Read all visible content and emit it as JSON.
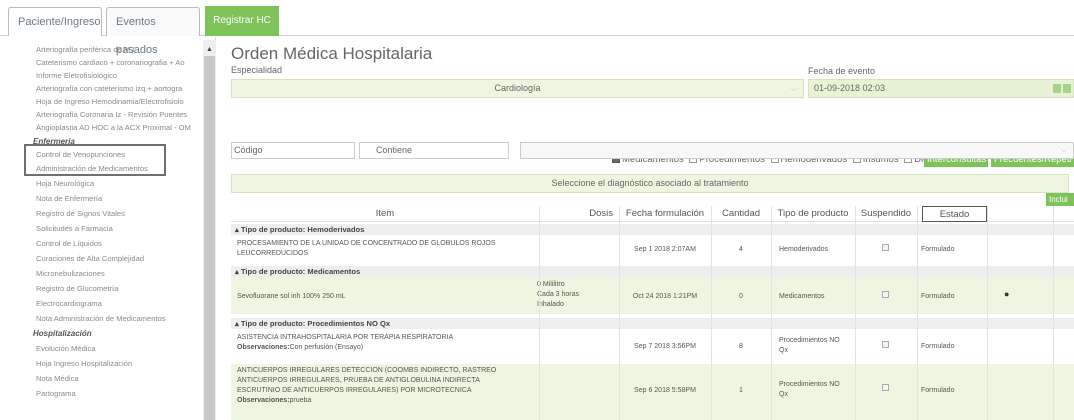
{
  "tabs": {
    "patient": "Paciente/Ingreso",
    "past_events": "Eventos pasados",
    "register": "Registrar HC"
  },
  "sidebar": {
    "items_top": [
      "Arteriografía periférica de M.I",
      "Cateterismo cardiaco + coronariografia + Ao",
      "Informe Eletrofisiológico",
      "Arteriografía con cateterismo izq.+ aortogra",
      "Hoja de Ingreso Hemodinamia/Electrofisiolo",
      "Arteriografía Coronaria Iz - Revisión Puentes",
      "Angioplastia AD HOC a la ACX Proximal - OM"
    ],
    "section_enfermeria": "Enfermería",
    "items_enfermeria": [
      "Control de Venopunciones",
      "Administración de Medicamentos",
      "Hoja Neurológica",
      "Nota de Enfermería",
      "Registro de Signos Vitales",
      "Solicitudes a Farmacia",
      "Control de Líquidos",
      "Curaciones de Alta Complejidad",
      "Micronebulizaciones",
      "Registro de Glucometría",
      "Electrocardiograma",
      "Nota Administración de Medicamentos"
    ],
    "section_hosp": "Hospitalización",
    "items_hosp": [
      "Evolución Médica",
      "Hoja Ingreso Hospitalización",
      "Nota Médica",
      "Partograma"
    ]
  },
  "form": {
    "title": "Orden Médica Hospitalaria",
    "especialidad_label": "Especialidad",
    "especialidad_value": "Cardiología",
    "fecha_label": "Fecha de evento",
    "fecha_value": "01-09-2018 02:03",
    "checks": {
      "medicamentos": "Medicamentos",
      "procedimientos": "Procedimientos",
      "hemoderivados": "Hemoderivados",
      "insumos": "Insumos",
      "dietas": "Dietas"
    },
    "interconsultas": "Interconsultas",
    "frecuentes": "Frecuentes/Repeti",
    "codigo_placeholder": "Código",
    "contiene_value": "Contiene",
    "diagnostico": "Seleccione el diagnóstico asociado al tratamiento",
    "incluir": "Inclui"
  },
  "table": {
    "headers": {
      "item": "Item",
      "dosis": "Dosis",
      "fecha": "Fecha formulación",
      "cantidad": "Cantidad",
      "tipo": "Tipo de producto",
      "suspendido": "Suspendido",
      "estado": "Estado"
    },
    "groups": {
      "g1": "Tipo de producto: Hemoderivados",
      "g2": "Tipo de producto: Medicamentos",
      "g3": "Tipo de producto: Procedimientos NO Qx"
    },
    "rows": {
      "r1": {
        "item1": "PROCESAMIENTO DE LA UNIDAD DE CONCENTRADO DE GLOBULOS ROJOS",
        "item2": "LEUCORREDUCIDOS",
        "fecha": "Sep 1 2018 2:07AM",
        "cantidad": "4",
        "tipo": "Hemoderivados",
        "estado": "Formulado"
      },
      "r2": {
        "item1": "Sevofluorane sol inh 100% 250 mL",
        "dosis1": "0 Mililitro",
        "dosis2": "Cada 3 horas",
        "dosis3": "Inhalado",
        "fecha": "Oct 24 2018 1:21PM",
        "cantidad": "0",
        "tipo": "Medicamentos",
        "estado": "Formulado"
      },
      "r3": {
        "item1": "ASISTENCIA INTRAHOSPITALARIA POR TERAPIA RESPIRATORIA",
        "obs_label": "Observaciones:",
        "obs": "Con perfusión (Ensayo)",
        "fecha": "Sep 7 2018 3:56PM",
        "cantidad": "8",
        "tipo1": "Procedimientos NO",
        "tipo2": "Qx",
        "estado": "Formulado"
      },
      "r4": {
        "item1": "ANTICUERPOS IRREGULARES DETECCION (COOMBS INDIRECTO, RASTREO",
        "item2": "ANTICUERPOS IRREGULARES, PRUEBA DE ANTIGLOBULINA INDIRECTA",
        "item3": "ESCRUTINIO DE ANTICUERPOS IRREGULARES) POR MICROTECNICA",
        "obs_label": "Observaciones:",
        "obs": "prueba",
        "fecha": "Sep 6 2018 5:58PM",
        "cantidad": "1",
        "tipo1": "Procedimientos NO",
        "tipo2": "Qx",
        "estado": "Formulado"
      }
    }
  }
}
